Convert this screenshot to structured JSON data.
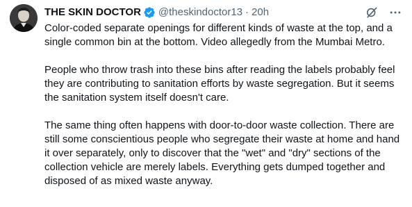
{
  "tweet": {
    "display_name": "THE SKIN DOCTOR",
    "handle": "@theskindoctor13",
    "separator": "·",
    "time": "20h",
    "verified_icon": "verified-badge-icon",
    "verified_color": "#1d9bf0",
    "actions": [
      "grok-icon",
      "more-icon"
    ],
    "paragraphs": [
      "Color-coded separate openings for different kinds of waste at the top, and a single common bin at the bottom. Video allegedly from the Mumbai Metro.",
      "People who throw trash into these bins after reading the labels probably feel they are contributing to sanitation efforts by waste segregation. But it seems the sanitation system itself doesn't care.",
      "The same thing often happens with door-to-door waste collection. There are still some conscientious people who segregate their waste at home and hand it over separately, only to discover that the \"wet\" and \"dry\" sections of the collection vehicle are merely labels. Everything gets dumped together and disposed of as mixed waste anyway."
    ]
  }
}
